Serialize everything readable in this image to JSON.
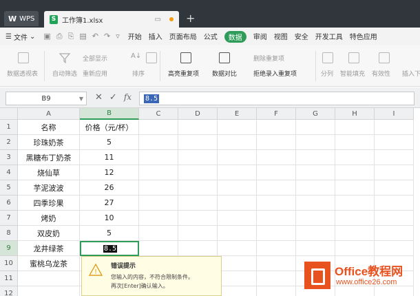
{
  "titlebar": {
    "app_label": "WPS",
    "doc_tab": "工作簿1.xlsx",
    "new_tab": "+"
  },
  "menubar": {
    "file_label": "文件",
    "items": [
      "开始",
      "插入",
      "页面布局",
      "公式",
      "数据",
      "审阅",
      "视图",
      "安全",
      "开发工具",
      "特色应用"
    ],
    "active": "数据"
  },
  "ribbon": {
    "pivot": "数据透视表",
    "autofilter": "自动筛选",
    "show_all": "全部显示",
    "reapply": "重新应用",
    "sort": "排序",
    "highlight_dup": "高亮重复项",
    "compare": "数据对比",
    "remove_dup": "删除重复项",
    "reject_dup": "拒绝录入重复项",
    "split": "分列",
    "smart_fill": "智能填充",
    "validity": "有效性",
    "insert_dd": "插入下"
  },
  "formula": {
    "namebox": "B9",
    "fx": "fx",
    "value": "8.5"
  },
  "grid": {
    "columns": [
      "A",
      "B",
      "C",
      "D",
      "E",
      "F",
      "G",
      "H",
      "I"
    ],
    "selected_col": "B",
    "rows": [
      {
        "num": "1",
        "a": "名称",
        "b": "价格（元/杯）"
      },
      {
        "num": "2",
        "a": "珍珠奶茶",
        "b": "5"
      },
      {
        "num": "3",
        "a": "黑糖布丁奶茶",
        "b": "11"
      },
      {
        "num": "4",
        "a": "烧仙草",
        "b": "12"
      },
      {
        "num": "5",
        "a": "芋泥波波",
        "b": "26"
      },
      {
        "num": "6",
        "a": "四季珍果",
        "b": "27"
      },
      {
        "num": "7",
        "a": "烤奶",
        "b": "10"
      },
      {
        "num": "8",
        "a": "双皮奶",
        "b": "5"
      },
      {
        "num": "9",
        "a": "龙井绿茶",
        "b": "8.5"
      },
      {
        "num": "10",
        "a": "蜜桃乌龙茶",
        "b": ""
      },
      {
        "num": "11",
        "a": "",
        "b": ""
      },
      {
        "num": "12",
        "a": "",
        "b": ""
      }
    ],
    "selected_row": "9"
  },
  "error_tip": {
    "title": "错误提示",
    "line1": "您输入的内容，不符合限制条件。",
    "line2": "再次[Enter]确认输入。"
  },
  "watermark": {
    "brand": "Office教程网",
    "url": "www.office26.com"
  },
  "colors": {
    "accent": "#2f9c5a",
    "titlebar": "#31363d",
    "watermark": "#e8521f"
  }
}
